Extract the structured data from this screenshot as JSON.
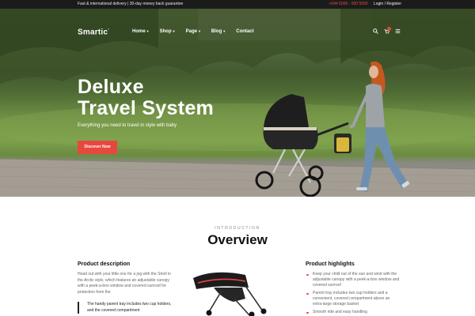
{
  "topbar": {
    "promo": "Fast & international delivery  |  30-day money back guarantee",
    "phone": "+044 5000 - 000 5000",
    "login": "Login / Register"
  },
  "header": {
    "logo": "Smartic",
    "nav": [
      {
        "label": "Home",
        "has_dropdown": true
      },
      {
        "label": "Shop",
        "has_dropdown": true
      },
      {
        "label": "Page",
        "has_dropdown": true
      },
      {
        "label": "Blog",
        "has_dropdown": true
      },
      {
        "label": "Contact",
        "has_dropdown": false
      }
    ],
    "icons": [
      "search-icon",
      "cart-icon",
      "menu-icon"
    ]
  },
  "hero": {
    "title_line1": "Deluxe",
    "title_line2": "Travel System",
    "subtitle": "Everything you need to travel in style with baby",
    "cta": "Discover Now"
  },
  "overview": {
    "eyebrow": "INTRODUCTION",
    "title": "Overview",
    "description_title": "Product description",
    "description_text": "Head out with your little one for a jog with the Stroll in the Arctic style, which features an adjustable canopy with a peek-a-boo window and covered sunroof for protection from the",
    "quote": "The handy parent tray includes two cup holders, and the covered compartment",
    "highlights_title": "Product highlights",
    "highlights": [
      "Keep your child out of the sun and wind with the adjustable canopy with a peek-a-boo window and covered sunroof",
      "Parent tray includes two cup holders and a convenient, covered compartment above an extra-large storage basket",
      "Smooth ride and easy handling"
    ]
  },
  "colors": {
    "accent": "#e8473f",
    "topbar": "#1b1b1b"
  }
}
